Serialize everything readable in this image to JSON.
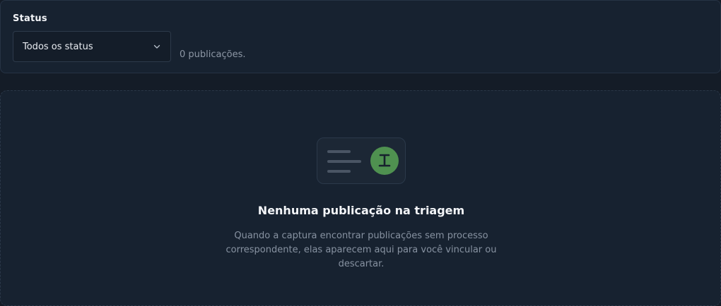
{
  "filter": {
    "label": "Status",
    "select": {
      "value": "Todos os status"
    },
    "count_text": "0 publicações."
  },
  "empty_state": {
    "title": "Nenhuma publicação na triagem",
    "description": "Quando a captura encontrar publicações sem processo correspondente, elas aparecem aqui para você vincular ou descartar."
  },
  "colors": {
    "background": "#141c27",
    "card": "#172230",
    "border": "#263344",
    "accent_green": "#4f9150",
    "muted_text": "#8792a1"
  },
  "icons": {
    "select_chevron": "chevron-down-icon",
    "illustration_badge": "text-cursor-icon"
  }
}
